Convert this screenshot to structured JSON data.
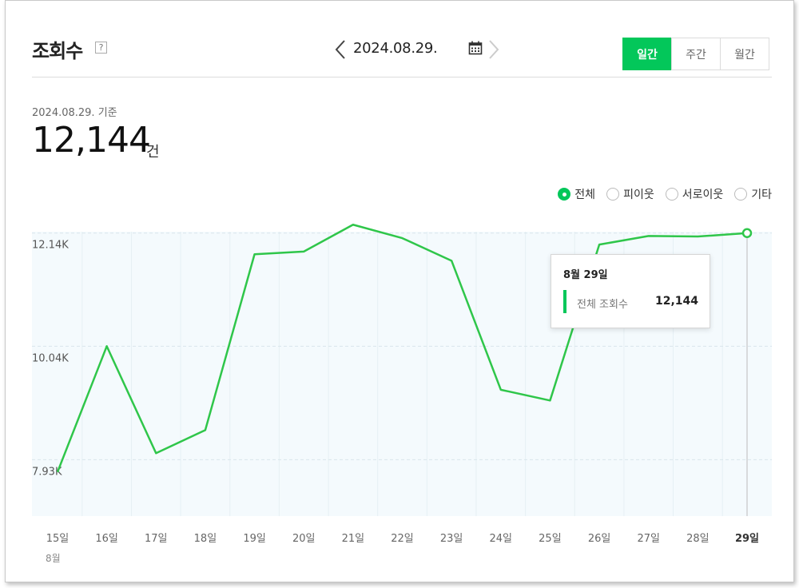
{
  "header": {
    "title": "조회수",
    "help_label": "?",
    "date": "2024.08.29.",
    "period_tabs": [
      "일간",
      "주간",
      "월간"
    ],
    "active_tab": "일간"
  },
  "summary": {
    "base_date": "2024.08.29. 기준",
    "total": "12,144",
    "unit": "건"
  },
  "legend": {
    "items": [
      "전체",
      "피이웃",
      "서로이웃",
      "기타"
    ],
    "selected": "전체"
  },
  "tooltip": {
    "title": "8월 29일",
    "label": "전체 조회수",
    "value": "12,144"
  },
  "month_label": "8월",
  "colors": {
    "accent": "#03c75a",
    "line": "#2fc64a",
    "plot_bg": "#f4fafd",
    "grid": "#d9e6ec"
  },
  "chart_data": {
    "type": "line",
    "categories": [
      "15일",
      "16일",
      "17일",
      "18일",
      "19일",
      "20일",
      "21일",
      "22일",
      "23일",
      "24일",
      "25일",
      "26일",
      "27일",
      "28일",
      "29일"
    ],
    "series": [
      {
        "name": "전체",
        "values": [
          7700,
          10040,
          8050,
          8480,
          11750,
          11800,
          12300,
          12050,
          11630,
          9230,
          9030,
          11930,
          12090,
          12080,
          12144
        ]
      }
    ],
    "y_ticks": [
      {
        "value": 12144,
        "label": "12.14K"
      },
      {
        "value": 10040,
        "label": "10.04K"
      },
      {
        "value": 7930,
        "label": "7.93K"
      }
    ],
    "ylim": [
      6880,
      12170
    ],
    "highlight_category": "29일",
    "grid": true
  }
}
